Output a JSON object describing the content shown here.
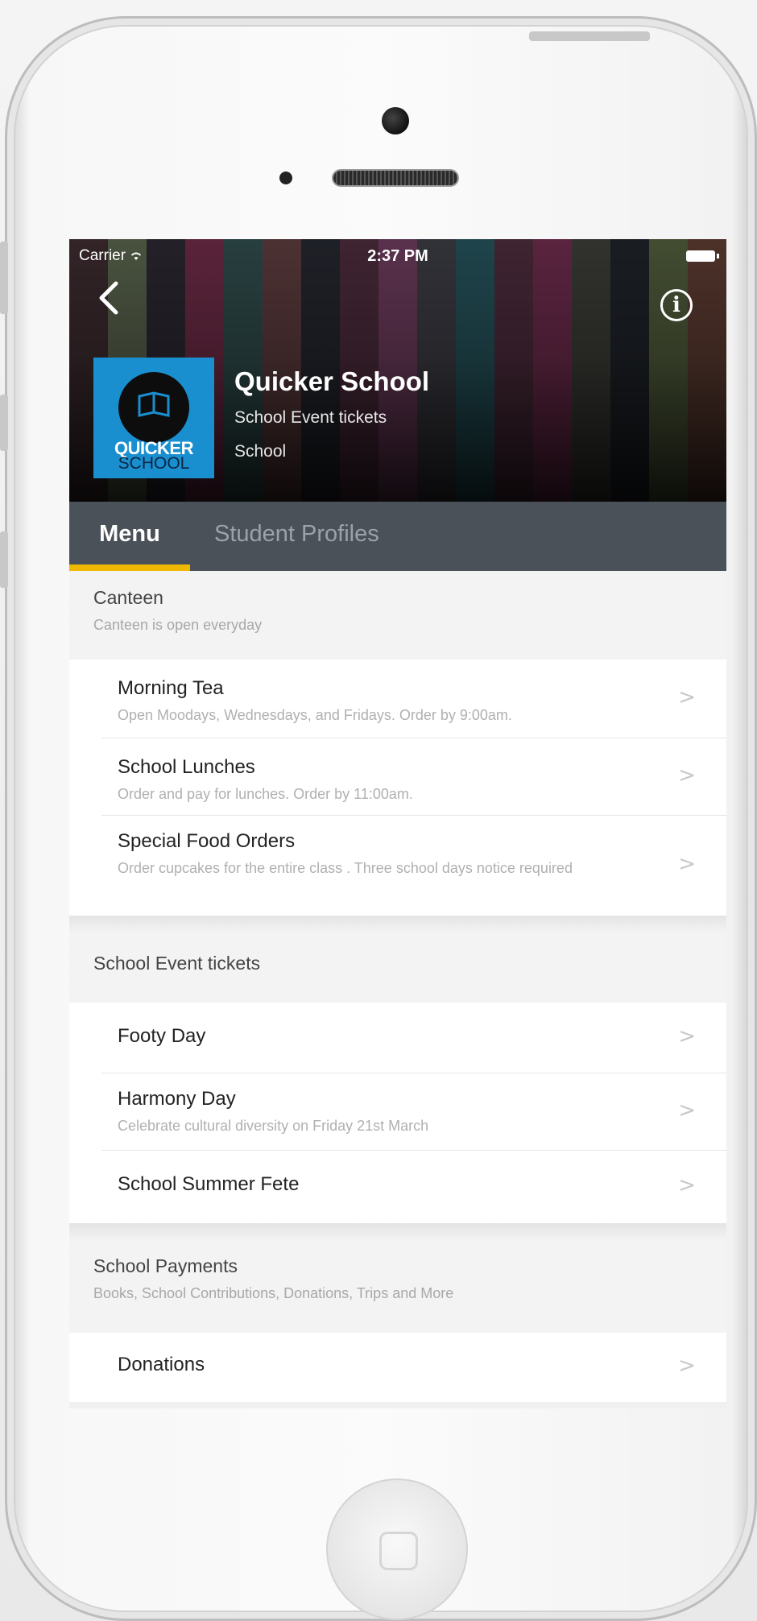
{
  "status_bar": {
    "carrier": "Carrier",
    "time": "2:37 PM"
  },
  "business": {
    "name": "Quicker School",
    "subtitle": "School Event tickets",
    "category": "School",
    "logo_text_top": "QUICKER",
    "logo_text_bottom": "SCHOOL"
  },
  "tabs": [
    {
      "label": "Menu",
      "active": true
    },
    {
      "label": "Student Profiles",
      "active": false
    }
  ],
  "sections": [
    {
      "title": "Canteen",
      "subtitle": "Canteen is open everyday",
      "items": [
        {
          "title": "Morning Tea",
          "subtitle": "Open Moodays, Wednesdays, and Fridays. Order by 9:00am."
        },
        {
          "title": "School Lunches",
          "subtitle": "Order and pay for lunches. Order by 11:00am."
        },
        {
          "title": "Special Food Orders",
          "subtitle": "Order cupcakes for the entire class . Three school days notice required"
        }
      ]
    },
    {
      "title": "School Event tickets",
      "subtitle": "",
      "items": [
        {
          "title": "Footy Day",
          "subtitle": ""
        },
        {
          "title": "Harmony Day",
          "subtitle": "Celebrate cultural diversity on Friday 21st March"
        },
        {
          "title": "School Summer Fete",
          "subtitle": ""
        }
      ]
    },
    {
      "title": "School Payments",
      "subtitle": "Books, School Contributions, Donations, Trips and More",
      "items": [
        {
          "title": "Donations",
          "subtitle": ""
        }
      ]
    }
  ],
  "colors": {
    "tab_bar": "#4b5158",
    "tab_indicator": "#f0b800",
    "logo_bg": "#1a8fd0"
  },
  "icons": {
    "back": "chevron-left-icon",
    "info": "info-icon",
    "row_chevron": "chevron-right-icon",
    "wifi": "wifi-icon",
    "battery": "battery-icon"
  }
}
